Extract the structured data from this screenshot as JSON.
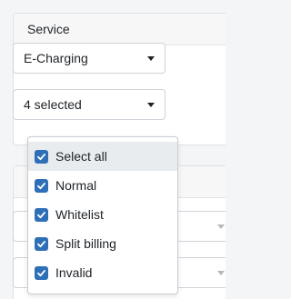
{
  "service_card": {
    "title": "Service",
    "service_select": {
      "value": "E-Charging"
    },
    "status_select": {
      "value": "4 selected"
    }
  },
  "status_menu": {
    "items": [
      {
        "label": "Select all",
        "checked": true,
        "highlighted": true
      },
      {
        "label": "Normal",
        "checked": true,
        "highlighted": false
      },
      {
        "label": "Whitelist",
        "checked": true,
        "highlighted": false
      },
      {
        "label": "Split billing",
        "checked": true,
        "highlighted": false
      },
      {
        "label": "Invalid",
        "checked": true,
        "highlighted": false
      }
    ]
  },
  "colors": {
    "checkbox": "#2f6fb7",
    "highlight": "#e9ecef",
    "page_background": "#f4f5f7"
  }
}
